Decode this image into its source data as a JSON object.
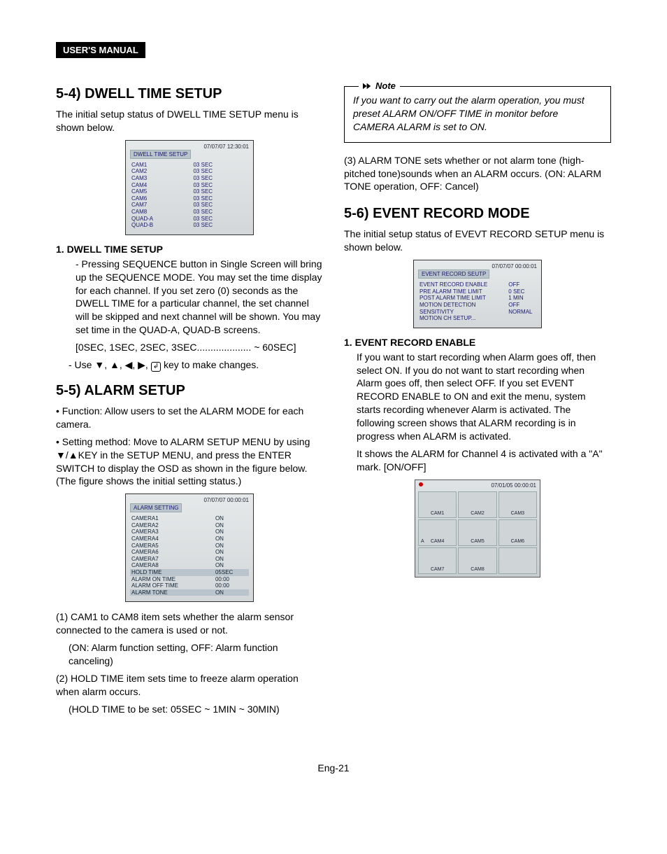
{
  "header": {
    "label": "USER'S MANUAL"
  },
  "sec54": {
    "title": "5-4) DWELL TIME SETUP",
    "intro": "The initial setup status of DWELL TIME SETUP menu is shown below.",
    "osd": {
      "time": "07/07/07  12:30:01",
      "tab": "DWELL TIME SETUP",
      "rows": [
        {
          "k": "CAM1",
          "v": "03 SEC"
        },
        {
          "k": "CAM2",
          "v": "03 SEC"
        },
        {
          "k": "CAM3",
          "v": "03 SEC"
        },
        {
          "k": "CAM4",
          "v": "03 SEC"
        },
        {
          "k": "CAM5",
          "v": "03 SEC"
        },
        {
          "k": "CAM6",
          "v": "03 SEC"
        },
        {
          "k": "CAM7",
          "v": "03 SEC"
        },
        {
          "k": "CAM8",
          "v": "03 SEC"
        },
        {
          "k": "QUAD-A",
          "v": "03 SEC"
        },
        {
          "k": "QUAD-B",
          "v": "03 SEC"
        }
      ]
    },
    "h1": "1. DWELL TIME SETUP",
    "p1": "- Pressing SEQUENCE button in Single Screen will bring up the SEQUENCE MODE. You may set the time display for each channel. If you set zero (0) seconds as the DWELL TIME for a particular channel, the set channel will be skipped and next channel will be shown. You may set time in the QUAD-A, QUAD-B screens.",
    "p1b": "[0SEC, 1SEC, 2SEC, 3SEC.................... ~ 60SEC]",
    "p2_pre": "- Use ",
    "p2_post": " key to make changes."
  },
  "sec55": {
    "title": "5-5) ALARM SETUP",
    "b1": "• Function: Allow users to set the ALARM MODE for each camera.",
    "b2": "• Setting method: Move to ALARM SETUP MENU by using ▼/▲KEY in the SETUP MENU, and press the ENTER SWITCH to display the OSD as shown in the figure below. (The figure shows the initial setting status.)",
    "osd": {
      "time": "07/07/07  00:00:01",
      "tab": "ALARM  SETTING",
      "rows": [
        {
          "k": "CAMERA1",
          "v": "ON"
        },
        {
          "k": "CAMERA2",
          "v": "ON"
        },
        {
          "k": "CAMERA3",
          "v": "ON"
        },
        {
          "k": "CAMERA4",
          "v": "ON"
        },
        {
          "k": "CAMERA5",
          "v": "ON"
        },
        {
          "k": "CAMERA6",
          "v": "ON"
        },
        {
          "k": "CAMERA7",
          "v": "ON"
        },
        {
          "k": "CAMERA8",
          "v": "ON"
        },
        {
          "k": "HOLD TIME",
          "v": "05SEC",
          "hl": true
        },
        {
          "k": "ALARM ON TIME",
          "v": "00:00"
        },
        {
          "k": "ALARM OFF TIME",
          "v": "00:00"
        },
        {
          "k": "ALARM TONE",
          "v": "ON",
          "hl": true
        }
      ]
    },
    "n1": "(1) CAM1 to CAM8 item sets whether the alarm sensor connected to the camera is used or not.",
    "n1b": "(ON: Alarm function setting, OFF: Alarm function canceling)",
    "n2": "(2) HOLD TIME item sets time to freeze alarm operation when alarm occurs.",
    "n2b": "(HOLD TIME to be set: 05SEC ~ 1MIN ~ 30MIN)"
  },
  "note": {
    "label": "Note",
    "text": "If you want to carry out the alarm operation, you must preset ALARM ON/OFF TIME in monitor before CAMERA ALARM is set to ON."
  },
  "sec55r": {
    "n3": "(3) ALARM TONE sets whether or not alarm tone (high-pitched tone)sounds when an ALARM occurs. (ON: ALARM TONE operation, OFF: Cancel)"
  },
  "sec56": {
    "title": "5-6) EVENT RECORD MODE",
    "intro": "The initial setup status of EVEVT RECORD SETUP menu is shown below.",
    "osd": {
      "time": "07/07/07  00:00:01",
      "tab": "EVENT RECORD SEUTP",
      "rows": [
        {
          "k": "EVENT RECORD ENABLE",
          "v": "OFF"
        },
        {
          "k": "PRE ALARM TIME LIMIT",
          "v": "0 SEC"
        },
        {
          "k": "POST ALARM TIME LIMIT",
          "v": "1 MIN"
        },
        {
          "k": "MOTION DETECTION",
          "v": "OFF"
        },
        {
          "k": "SENSITIVITY",
          "v": "NORMAL"
        },
        {
          "k": "MOTION CH SETUP...",
          "v": ""
        }
      ]
    },
    "h1": "1. EVENT RECORD ENABLE",
    "p1": "If you want to start recording when Alarm goes off, then select ON. If you do not want to start recording when Alarm goes off, then select OFF.  If you set EVENT RECORD ENABLE to ON and exit the menu, system starts recording whenever Alarm is activated. The following screen shows that ALARM recording is in progress when ALARM is activated.",
    "p2": "It shows the ALARM for Channel 4 is activated with a \"A\" mark. [ON/OFF]",
    "grid": {
      "time": "07/01/05  00:00:01",
      "cells": [
        "CAM1",
        "CAM2",
        "CAM3",
        "CAM4",
        "CAM5",
        "CAM6",
        "CAM7",
        "CAM8",
        ""
      ],
      "a_index": 3
    }
  },
  "footer": "Eng-21"
}
